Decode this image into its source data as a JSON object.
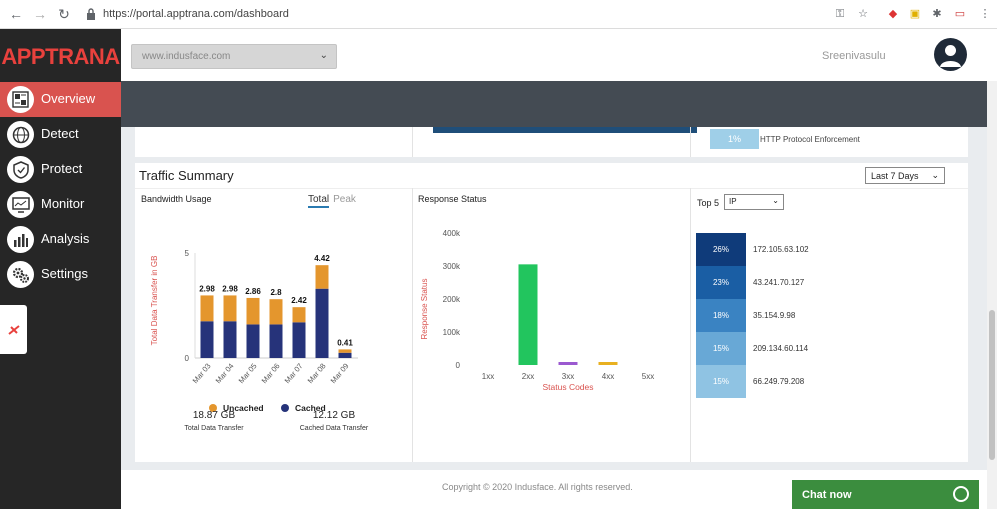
{
  "browser": {
    "url": "https://portal.apptrana.com/dashboard"
  },
  "brand": {
    "part1": "APP",
    "part2": "TRANA"
  },
  "sidebar": {
    "items": [
      {
        "label": "Overview",
        "icon": "overview-icon",
        "active": true
      },
      {
        "label": "Detect",
        "icon": "globe-icon",
        "active": false
      },
      {
        "label": "Protect",
        "icon": "shield-icon",
        "active": false
      },
      {
        "label": "Monitor",
        "icon": "monitor-icon",
        "active": false
      },
      {
        "label": "Analysis",
        "icon": "bar-chart-icon",
        "active": false
      },
      {
        "label": "Settings",
        "icon": "gears-icon",
        "active": false
      }
    ]
  },
  "header": {
    "domain_select": "www.indusface.com",
    "username": "Sreenivasulu"
  },
  "top_card": {
    "percent": "1%",
    "label": "HTTP Protocol Enforcement"
  },
  "traffic": {
    "title": "Traffic Summary",
    "range": "Last 7 Days",
    "bandwidth": {
      "title": "Bandwidth Usage",
      "tab_total": "Total",
      "tab_peak": "Peak",
      "total_value": "18.87 GB",
      "total_label": "Total Data Transfer",
      "cached_value": "12.12 GB",
      "cached_label": "Cached Data Transfer"
    },
    "response": {
      "title": "Response Status"
    },
    "top5": {
      "label": "Top 5",
      "select": "IP",
      "rows": [
        {
          "pct": "26%",
          "ip": "172.105.63.102",
          "color": "#0f3b7a"
        },
        {
          "pct": "23%",
          "ip": "43.241.70.127",
          "color": "#1a5ea4"
        },
        {
          "pct": "18%",
          "ip": "35.154.9.98",
          "color": "#3a83c2"
        },
        {
          "pct": "15%",
          "ip": "209.134.60.114",
          "color": "#68a8d6"
        },
        {
          "pct": "15%",
          "ip": "66.249.79.208",
          "color": "#8fc3e3"
        }
      ]
    }
  },
  "footer": {
    "copyright": "Copyright © 2020 Indusface. All rights reserved."
  },
  "chat": {
    "label": "Chat now"
  },
  "chart_data": [
    {
      "type": "bar",
      "stacked": true,
      "categories": [
        "Mar 03",
        "Mar 04",
        "Mar 05",
        "Mar 06",
        "Mar 07",
        "Mar 08",
        "Mar 09"
      ],
      "series": [
        {
          "name": "Cached",
          "values": [
            1.75,
            1.75,
            1.6,
            1.6,
            1.7,
            3.3,
            0.25
          ],
          "color": "#26337a"
        },
        {
          "name": "Uncached",
          "values": [
            1.23,
            1.23,
            1.26,
            1.2,
            0.72,
            1.12,
            0.16
          ],
          "color": "#e4962d"
        }
      ],
      "data_labels": [
        "2.98",
        "2.98",
        "2.86",
        "2.8",
        "2.42",
        "4.42",
        "0.41"
      ],
      "ylabel": "Total Data Transfer in GB",
      "yticks": [
        "0",
        "5"
      ],
      "ylim": [
        0,
        5
      ],
      "legend": [
        "Uncached",
        "Cached"
      ]
    },
    {
      "type": "bar",
      "categories": [
        "1xx",
        "2xx",
        "3xx",
        "4xx",
        "5xx"
      ],
      "values": [
        0,
        305000,
        8000,
        8000,
        0
      ],
      "colors": [
        "#22c55e",
        "#22c55e",
        "#9b59d0",
        "#e8b020",
        "#cccccc"
      ],
      "xlabel": "Status Codes",
      "ylabel": "Response Status",
      "yticks": [
        "0",
        "100k",
        "200k",
        "300k",
        "400k"
      ],
      "ylim": [
        0,
        400000
      ]
    }
  ]
}
